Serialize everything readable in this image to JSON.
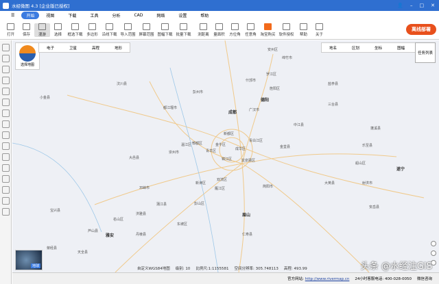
{
  "title": "水经微图 4.3 [企业版已授权]",
  "menu": [
    "开始",
    "视图",
    "下载",
    "工具",
    "分析",
    "CAD",
    "网络",
    "设置",
    "帮助"
  ],
  "toolbar": [
    "打开",
    "保存",
    "漫游",
    "选择",
    "框选下载",
    "多边形",
    "沿线下载",
    "导入范围",
    "屏幕范围",
    "图幅下载",
    "批量下载",
    "测距离",
    "量面积",
    "方位角",
    "任意角",
    "淘宝购买",
    "软件授权",
    "帮助",
    "关于"
  ],
  "offline_button": "离线部署",
  "map_selector": "选择地图",
  "map_types": [
    "电子",
    "卫星",
    "高程",
    "地形"
  ],
  "map_tools": [
    "地名",
    "区划",
    "坐标",
    "图幅",
    "瓦片"
  ],
  "task_list": "任务列表",
  "globe_label": "地球",
  "info": {
    "crs": "自定义WGS84地图",
    "level_label": "级别:",
    "level": "10",
    "scale_label": "比例尺:",
    "scale": "1:1155581",
    "res_label": "空间分辨率:",
    "resolution": "305.748113",
    "elev_label": "高程:",
    "elevation": "493.99"
  },
  "status": {
    "site_label": "官方网站:",
    "site": "http://www.rivermap.cn",
    "phone_label": "24小时客服电话:",
    "phone": "400-028-0050",
    "wechat": "微信咨询"
  },
  "watermark": "头条 @水经注GIS",
  "labels": {
    "cities": [
      "成都",
      "德阳",
      "雅安",
      "遂宁",
      "眉山"
    ],
    "places": [
      "安州区",
      "绵竹市",
      "罗江区",
      "什邡市",
      "旌阳区",
      "广汉市",
      "中江县",
      "三台县",
      "彭州市",
      "都江堰市",
      "新都区",
      "青白江区",
      "金堂县",
      "郫都区",
      "金牛区",
      "成华区",
      "温江区",
      "青羊区",
      "锦江区",
      "龙泉驿区",
      "崇州市",
      "大邑县",
      "双流区",
      "简阳市",
      "新津区",
      "邛崃市",
      "蒲江县",
      "彭山区",
      "仁寿县",
      "丹棱县",
      "东坡区",
      "名山区",
      "芦山县",
      "天全县",
      "宝兴县",
      "汶川县",
      "小金县",
      "荥经县",
      "洪雅县",
      "乐至县",
      "安岳县",
      "大英县",
      "射洪市",
      "船山区",
      "蓬溪县",
      "盐亭县",
      "雁江区"
    ]
  }
}
